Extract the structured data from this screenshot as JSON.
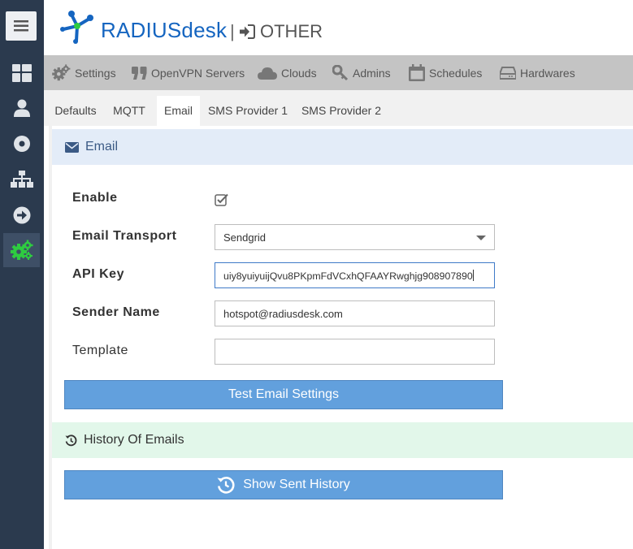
{
  "header": {
    "brand": "RADIUSdesk",
    "separator": "|",
    "section": "OTHER"
  },
  "sidebar": {
    "items": [
      {
        "icon": "dashboard-icon"
      },
      {
        "icon": "user-icon"
      },
      {
        "icon": "disc-icon"
      },
      {
        "icon": "sitemap-icon"
      },
      {
        "icon": "arrow-right-circle-icon"
      },
      {
        "icon": "cogs-icon",
        "active": true
      }
    ]
  },
  "top_tabs": [
    {
      "label": "Settings",
      "icon": "cogs-icon"
    },
    {
      "label": "OpenVPN Servers",
      "icon": "quote-icon"
    },
    {
      "label": "Clouds",
      "icon": "cloud-icon"
    },
    {
      "label": "Admins",
      "icon": "key-icon"
    },
    {
      "label": "Schedules",
      "icon": "calendar-icon"
    },
    {
      "label": "Hardwares",
      "icon": "hdd-icon"
    }
  ],
  "sub_tabs": [
    {
      "label": "Defaults"
    },
    {
      "label": "MQTT"
    },
    {
      "label": "Email",
      "active": true
    },
    {
      "label": "SMS Provider 1"
    },
    {
      "label": "SMS Provider 2"
    }
  ],
  "email_panel": {
    "title": "Email",
    "enable_label": "Enable",
    "enable_checked": true,
    "transport_label": "Email Transport",
    "transport_value": "Sendgrid",
    "api_key_label": "API Key",
    "api_key_value": "uiy8yuiyuijQvu8PKpmFdVCxhQFAAYRwghjg908907890",
    "sender_label": "Sender Name",
    "sender_value": "hotspot@radiusdesk.com",
    "template_label": "Template",
    "template_value": "",
    "test_button": "Test Email Settings"
  },
  "history_panel": {
    "title": "History Of Emails",
    "show_button": "Show Sent History"
  },
  "colors": {
    "sidebar_bg": "#2b3a4e",
    "brand_blue": "#1565c0",
    "button_blue": "#62a0dd",
    "active_icon_green": "#2ecc40"
  }
}
